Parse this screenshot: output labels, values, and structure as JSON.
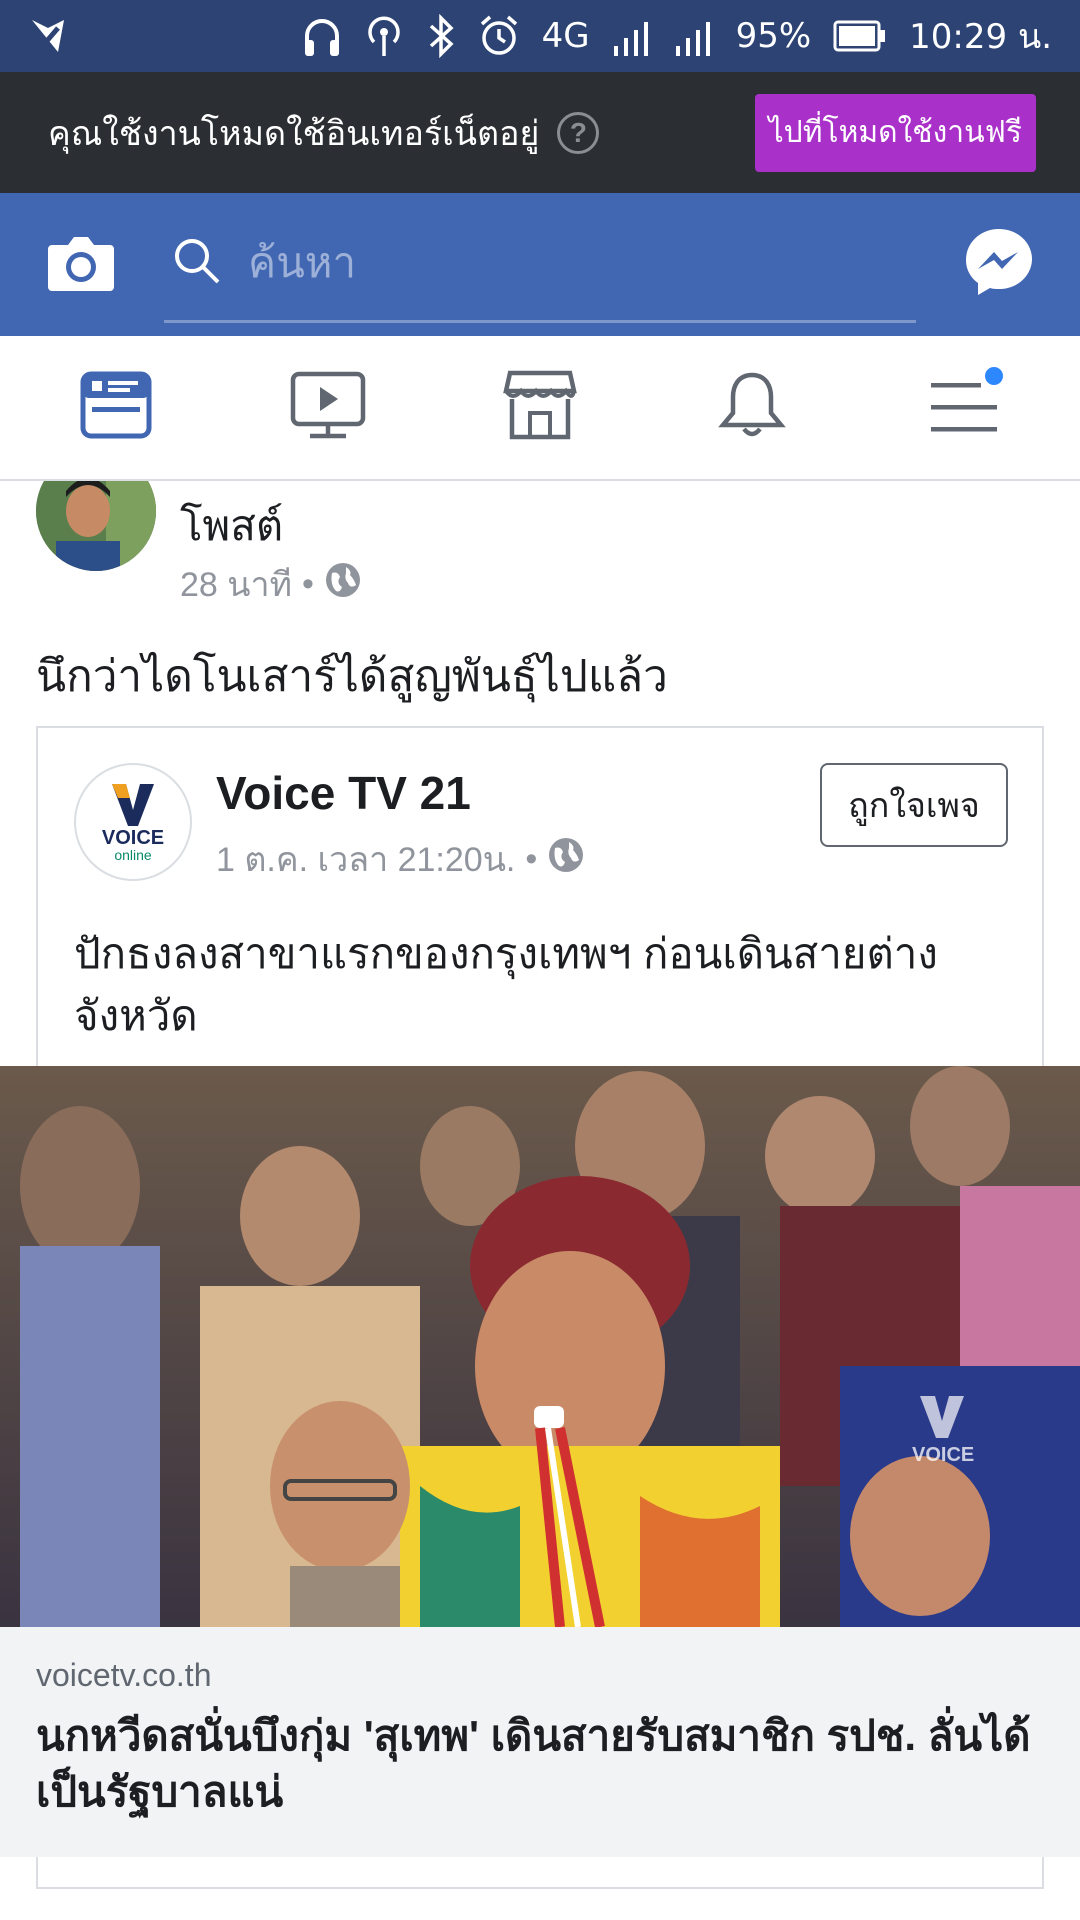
{
  "status_bar": {
    "battery": "95%",
    "time": "10:29 น.",
    "network": "4G",
    "sim1": "1",
    "sim2": "2"
  },
  "free_mode_banner": {
    "message": "คุณใช้งานโหมดใช้อินเทอร์เน็ตอยู่",
    "help": "?",
    "button_label": "ไปที่โหมดใช้งานฟรี"
  },
  "header": {
    "search_placeholder": "ค้นหา"
  },
  "tabs": [
    {
      "name": "news-feed",
      "icon": "news-feed-icon",
      "active": true
    },
    {
      "name": "watch",
      "icon": "video-icon",
      "active": false
    },
    {
      "name": "marketplace",
      "icon": "marketplace-icon",
      "active": false
    },
    {
      "name": "notifications",
      "icon": "bell-icon",
      "active": false
    },
    {
      "name": "menu",
      "icon": "menu-icon",
      "active": false,
      "badge": true
    }
  ],
  "post": {
    "author_line2": "โพสต์",
    "time": "28 นาที",
    "text": "นึกว่าไดโนเสาร์ได้สูญพันธ์ุไปแล้ว",
    "shared": {
      "page_name": "Voice TV 21",
      "page_logo_text": "VOICE",
      "page_logo_sub": "online",
      "time": "1 ต.ค. เวลา 21:20น.",
      "like_button": "ถูกใจเพจ",
      "text": "ปักธงลงสาขาแรกของกรุงเทพฯ ก่อนเดินสายต่างจังหวัด",
      "photo_watermark": "VOICE",
      "link_domain": "voicetv.co.th",
      "link_title": "นกหวีดสนั่นบึงกุ่ม 'สุเทพ' เดินสายรับสมาชิก รปช. ลั่นได้เป็นรัฐบาลแน่"
    }
  },
  "colors": {
    "status_bar": "#2d4373",
    "brand_blue": "#4267b2",
    "free_button": "#a931c9",
    "banner": "#2b2e33"
  }
}
